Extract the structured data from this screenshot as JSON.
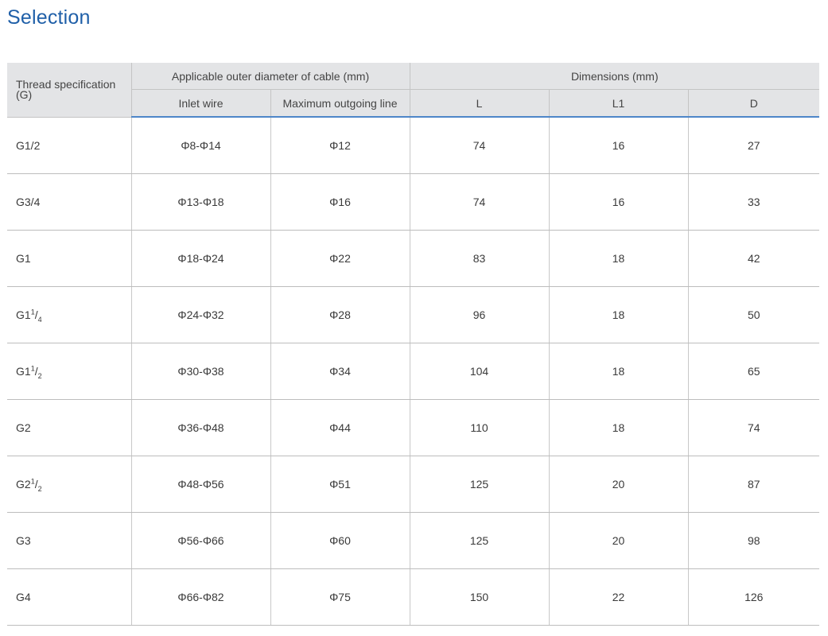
{
  "title": "Selection",
  "table": {
    "header": {
      "thread_spec_line1": "Thread specification",
      "thread_spec_line2": "(G)",
      "group_cable": "Applicable outer diameter of cable (mm)",
      "group_dimensions": "Dimensions  (mm)",
      "inlet_wire": "Inlet wire",
      "max_outgoing": "Maximum outgoing line",
      "col_L": "L",
      "col_L1": "L1",
      "col_D": "D"
    },
    "rows": [
      {
        "thread": {
          "base": "G1/2",
          "sup": "",
          "sub": ""
        },
        "inlet": "Φ8-Φ14",
        "max": "Φ12",
        "L": "74",
        "L1": "16",
        "D": "27"
      },
      {
        "thread": {
          "base": "G3/4",
          "sup": "",
          "sub": ""
        },
        "inlet": "Φ13-Φ18",
        "max": "Φ16",
        "L": "74",
        "L1": "16",
        "D": "33"
      },
      {
        "thread": {
          "base": "G1",
          "sup": "",
          "sub": ""
        },
        "inlet": "Φ18-Φ24",
        "max": "Φ22",
        "L": "83",
        "L1": "18",
        "D": "42"
      },
      {
        "thread": {
          "base": "G1",
          "sup": "1",
          "sub": "4"
        },
        "inlet": "Φ24-Φ32",
        "max": "Φ28",
        "L": "96",
        "L1": "18",
        "D": "50"
      },
      {
        "thread": {
          "base": "G1",
          "sup": "1",
          "sub": "2"
        },
        "inlet": "Φ30-Φ38",
        "max": "Φ34",
        "L": "104",
        "L1": "18",
        "D": "65"
      },
      {
        "thread": {
          "base": "G2",
          "sup": "",
          "sub": ""
        },
        "inlet": "Φ36-Φ48",
        "max": "Φ44",
        "L": "110",
        "L1": "18",
        "D": "74"
      },
      {
        "thread": {
          "base": "G2",
          "sup": "1",
          "sub": "2"
        },
        "inlet": "Φ48-Φ56",
        "max": "Φ51",
        "L": "125",
        "L1": "20",
        "D": "87"
      },
      {
        "thread": {
          "base": "G3",
          "sup": "",
          "sub": ""
        },
        "inlet": "Φ56-Φ66",
        "max": "Φ60",
        "L": "125",
        "L1": "20",
        "D": "98"
      },
      {
        "thread": {
          "base": "G4",
          "sup": "",
          "sub": ""
        },
        "inlet": "Φ66-Φ82",
        "max": "Φ75",
        "L": "150",
        "L1": "22",
        "D": "126"
      }
    ]
  },
  "colors": {
    "title": "#1f5fa8",
    "header_bg": "#e3e4e6",
    "header_rule": "#4e86c8"
  }
}
